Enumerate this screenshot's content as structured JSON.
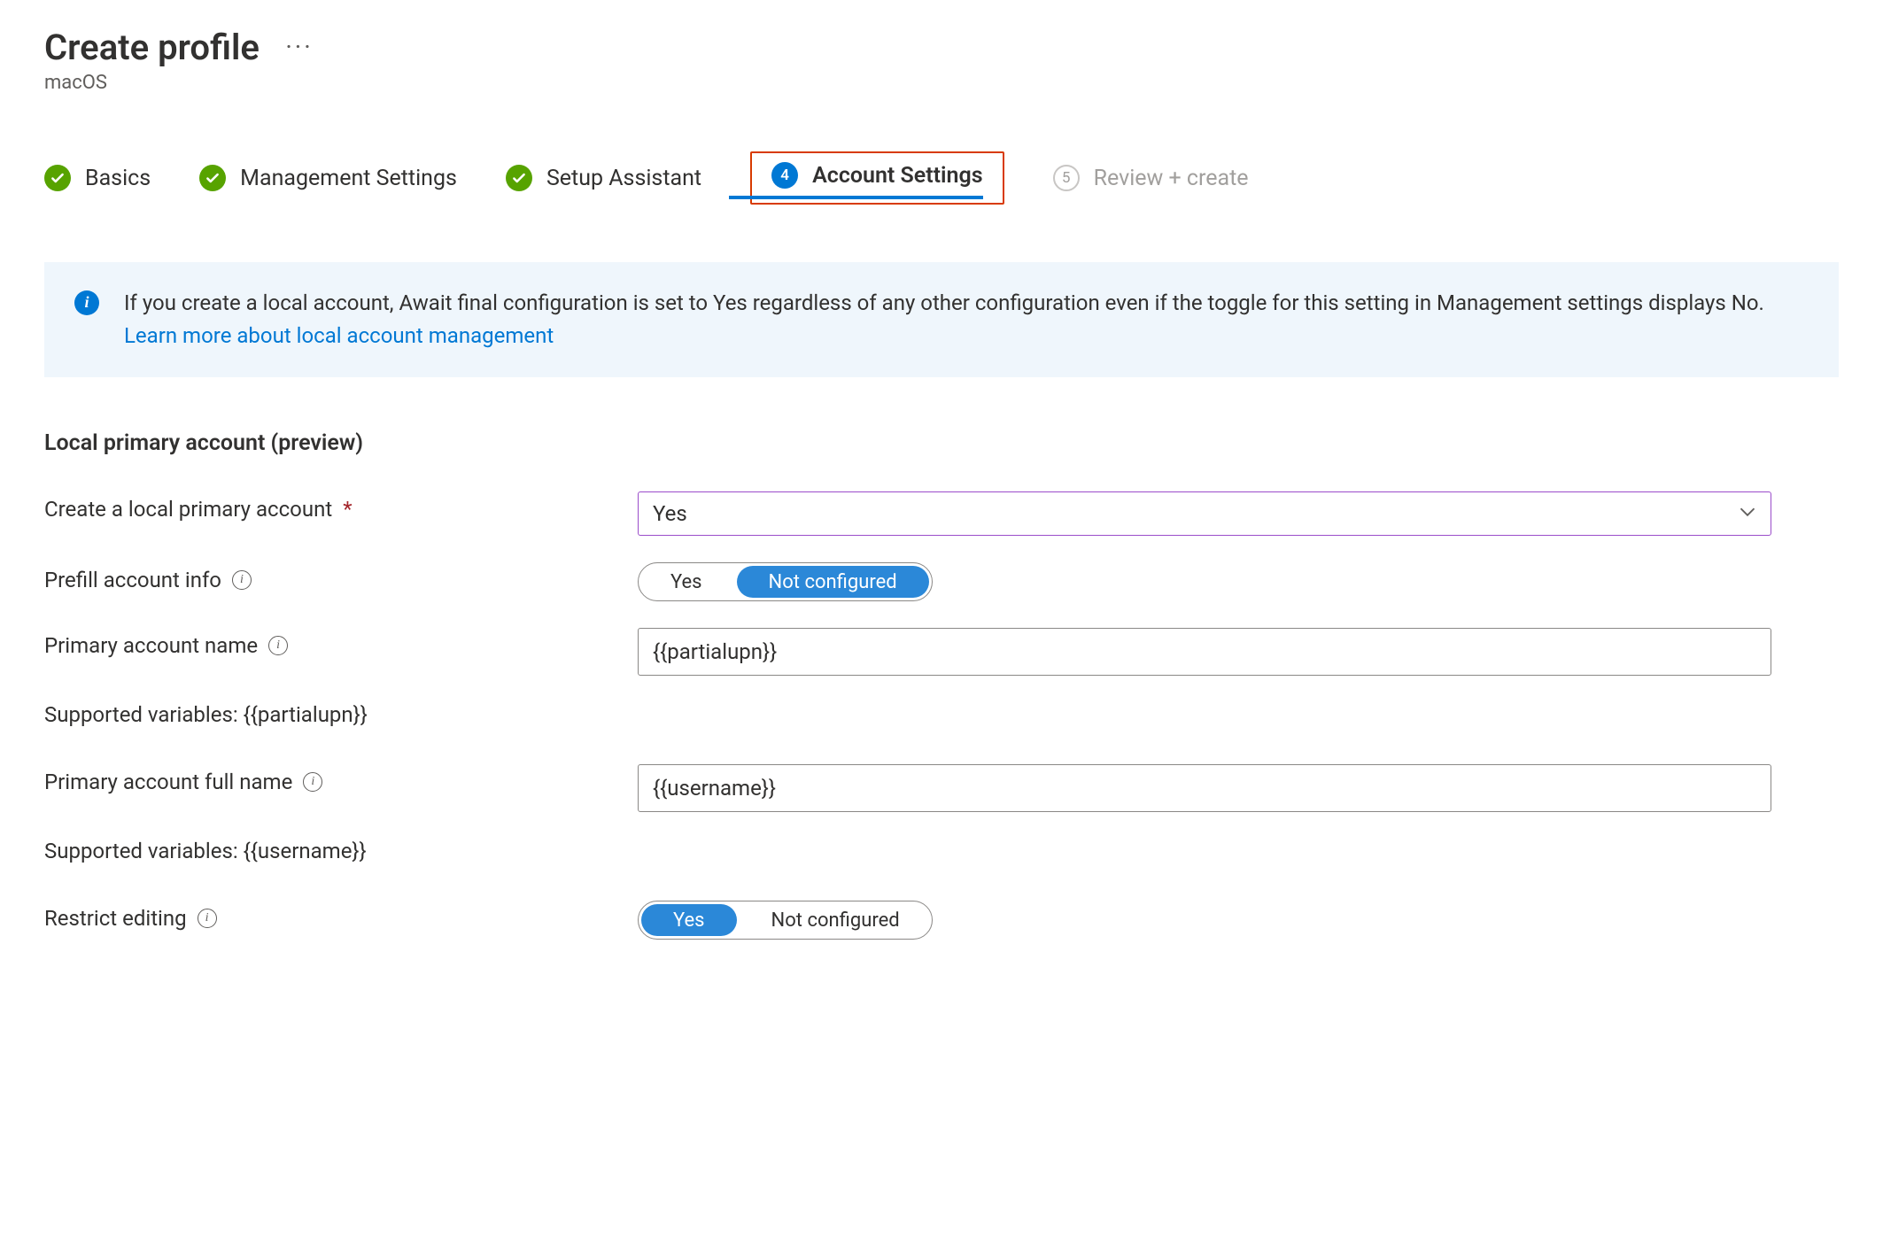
{
  "header": {
    "title": "Create profile",
    "ellipsis": "···",
    "subtitle": "macOS"
  },
  "steps": {
    "basics": "Basics",
    "management": "Management Settings",
    "setup": "Setup Assistant",
    "account_number": "4",
    "account": "Account Settings",
    "review_number": "5",
    "review": "Review + create"
  },
  "banner": {
    "text": "If you create a local account, Await final configuration is set to Yes regardless of any other configuration even if the toggle for this setting in Management settings displays No. ",
    "link": "Learn more about local account management"
  },
  "section": {
    "title": "Local primary account (preview)"
  },
  "form": {
    "create_local": {
      "label": "Create a local primary account",
      "value": "Yes"
    },
    "prefill": {
      "label": "Prefill account info",
      "yes": "Yes",
      "notconfigured": "Not configured"
    },
    "primary_name": {
      "label": "Primary account name",
      "value": "{{partialupn}}",
      "hint": "Supported variables: {{partialupn}}"
    },
    "primary_full_name": {
      "label": "Primary account full name",
      "value": "{{username}}",
      "hint": "Supported variables: {{username}}"
    },
    "restrict": {
      "label": "Restrict editing",
      "yes": "Yes",
      "notconfigured": "Not configured"
    }
  }
}
